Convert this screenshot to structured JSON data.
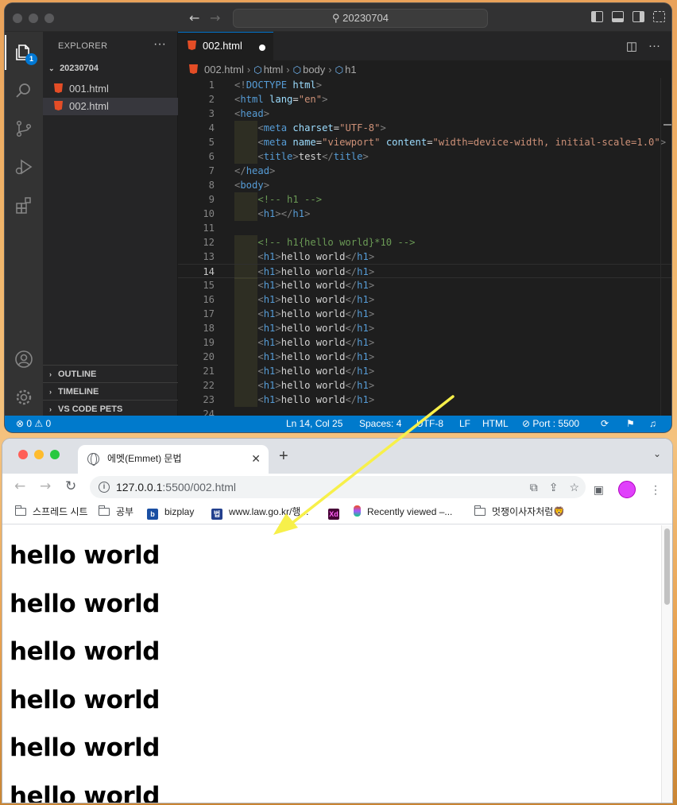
{
  "vscode": {
    "search_text": "20230704",
    "explorer_title": "EXPLORER",
    "explorer_more": "···",
    "badge": "1",
    "folder_name": "20230704",
    "files": [
      "001.html",
      "002.html"
    ],
    "sections": [
      "OUTLINE",
      "TIMELINE",
      "VS CODE PETS"
    ],
    "tab_label": "002.html",
    "breadcrumb": [
      "002.html",
      "html",
      "body",
      "h1"
    ],
    "code_lines": [
      {
        "n": "1",
        "html": "<span class='tg'>&lt;!</span><span class='tn'>DOCTYPE</span> <span class='at'>html</span><span class='tg'>&gt;</span>"
      },
      {
        "n": "2",
        "html": "<span class='tg'>&lt;</span><span class='tn'>html</span> <span class='at'>lang</span><span class='tx'>=</span><span class='av'>\"en\"</span><span class='tg'>&gt;</span>"
      },
      {
        "n": "3",
        "html": "<span class='tg'>&lt;</span><span class='tn'>head</span><span class='tg'>&gt;</span>"
      },
      {
        "n": "4",
        "indent": true,
        "html": "    <span class='tg'>&lt;</span><span class='tn'>meta</span> <span class='at'>charset</span><span class='tx'>=</span><span class='av'>\"UTF-8\"</span><span class='tg'>&gt;</span>"
      },
      {
        "n": "5",
        "indent": true,
        "html": "    <span class='tg'>&lt;</span><span class='tn'>meta</span> <span class='at'>name</span><span class='tx'>=</span><span class='av'>\"viewport\"</span> <span class='at'>content</span><span class='tx'>=</span><span class='av'>\"width=device-width, initial-scale=1.0\"</span><span class='tg'>&gt;</span>"
      },
      {
        "n": "6",
        "indent": true,
        "html": "    <span class='tg'>&lt;</span><span class='tn'>title</span><span class='tg'>&gt;</span><span class='tx'>test</span><span class='tg'>&lt;/</span><span class='tn'>title</span><span class='tg'>&gt;</span>"
      },
      {
        "n": "7",
        "html": "<span class='tg'>&lt;/</span><span class='tn'>head</span><span class='tg'>&gt;</span>"
      },
      {
        "n": "8",
        "html": "<span class='tg'>&lt;</span><span class='tn'>body</span><span class='tg'>&gt;</span>"
      },
      {
        "n": "9",
        "indent": true,
        "html": "    <span class='cm'>&lt;!-- h1 --&gt;</span>"
      },
      {
        "n": "10",
        "indent": true,
        "html": "    <span class='tg'>&lt;</span><span class='tn'>h1</span><span class='tg'>&gt;&lt;/</span><span class='tn'>h1</span><span class='tg'>&gt;</span>"
      },
      {
        "n": "11",
        "html": ""
      },
      {
        "n": "12",
        "indent": true,
        "html": "    <span class='cm'>&lt;!-- h1{hello world}*10 --&gt;</span>"
      },
      {
        "n": "13",
        "indent": true,
        "html": "    <span class='tg'>&lt;</span><span class='tn'>h1</span><span class='tg'>&gt;</span><span class='tx'>hello world</span><span class='tg'>&lt;/</span><span class='tn'>h1</span><span class='tg'>&gt;</span>"
      },
      {
        "n": "14",
        "indent": true,
        "cur": true,
        "html": "    <span class='tg'>&lt;</span><span class='tn'>h1</span><span class='tg'>&gt;</span><span class='tx'>hello world</span><span class='tg'>&lt;/</span><span class='tn'>h1</span><span class='tg'>&gt;</span>"
      },
      {
        "n": "15",
        "indent": true,
        "html": "    <span class='tg'>&lt;</span><span class='tn'>h1</span><span class='tg'>&gt;</span><span class='tx'>hello world</span><span class='tg'>&lt;/</span><span class='tn'>h1</span><span class='tg'>&gt;</span>"
      },
      {
        "n": "16",
        "indent": true,
        "html": "    <span class='tg'>&lt;</span><span class='tn'>h1</span><span class='tg'>&gt;</span><span class='tx'>hello world</span><span class='tg'>&lt;/</span><span class='tn'>h1</span><span class='tg'>&gt;</span>"
      },
      {
        "n": "17",
        "indent": true,
        "html": "    <span class='tg'>&lt;</span><span class='tn'>h1</span><span class='tg'>&gt;</span><span class='tx'>hello world</span><span class='tg'>&lt;/</span><span class='tn'>h1</span><span class='tg'>&gt;</span>"
      },
      {
        "n": "18",
        "indent": true,
        "html": "    <span class='tg'>&lt;</span><span class='tn'>h1</span><span class='tg'>&gt;</span><span class='tx'>hello world</span><span class='tg'>&lt;/</span><span class='tn'>h1</span><span class='tg'>&gt;</span>"
      },
      {
        "n": "19",
        "indent": true,
        "html": "    <span class='tg'>&lt;</span><span class='tn'>h1</span><span class='tg'>&gt;</span><span class='tx'>hello world</span><span class='tg'>&lt;/</span><span class='tn'>h1</span><span class='tg'>&gt;</span>"
      },
      {
        "n": "20",
        "indent": true,
        "html": "    <span class='tg'>&lt;</span><span class='tn'>h1</span><span class='tg'>&gt;</span><span class='tx'>hello world</span><span class='tg'>&lt;/</span><span class='tn'>h1</span><span class='tg'>&gt;</span>"
      },
      {
        "n": "21",
        "indent": true,
        "html": "    <span class='tg'>&lt;</span><span class='tn'>h1</span><span class='tg'>&gt;</span><span class='tx'>hello world</span><span class='tg'>&lt;/</span><span class='tn'>h1</span><span class='tg'>&gt;</span>"
      },
      {
        "n": "22",
        "indent": true,
        "html": "    <span class='tg'>&lt;</span><span class='tn'>h1</span><span class='tg'>&gt;</span><span class='tx'>hello world</span><span class='tg'>&lt;/</span><span class='tn'>h1</span><span class='tg'>&gt;</span>"
      },
      {
        "n": "23",
        "indent": true,
        "html": "    <span class='tg'>&lt;</span><span class='tn'>h1</span><span class='tg'>&gt;</span><span class='tx'>hello world</span><span class='tg'>&lt;/</span><span class='tn'>h1</span><span class='tg'>&gt;</span>"
      },
      {
        "n": "24",
        "html": ""
      }
    ],
    "status": {
      "problems": "⊗ 0 ⚠ 0",
      "position": "Ln 14, Col 25",
      "spaces": "Spaces: 4",
      "encoding": "UTF-8",
      "eol": "LF",
      "language": "HTML",
      "port": "⊘ Port : 5500"
    }
  },
  "browser": {
    "tab_title": "에멧(Emmet) 문법",
    "url_host": "127.0.0.1",
    "url_rest": ":5500/002.html",
    "bookmarks": [
      {
        "label": "스프레드 시트",
        "kind": "folder"
      },
      {
        "label": "공부",
        "kind": "folder"
      },
      {
        "label": "bizplay",
        "kind": "b"
      },
      {
        "label": "www.law.go.kr/행...",
        "kind": "law"
      },
      {
        "label": "",
        "kind": "xd"
      },
      {
        "label": "Recently viewed –...",
        "kind": "figma"
      },
      {
        "label": "멋쟁이사자처럼🦁",
        "kind": "folder"
      }
    ],
    "headings": [
      "hello world",
      "hello world",
      "hello world",
      "hello world",
      "hello world",
      "hello world"
    ]
  },
  "colors": {
    "vscode_accent": "#007acc",
    "arrow": "#f7f04a",
    "avatar": "#e040fb"
  }
}
